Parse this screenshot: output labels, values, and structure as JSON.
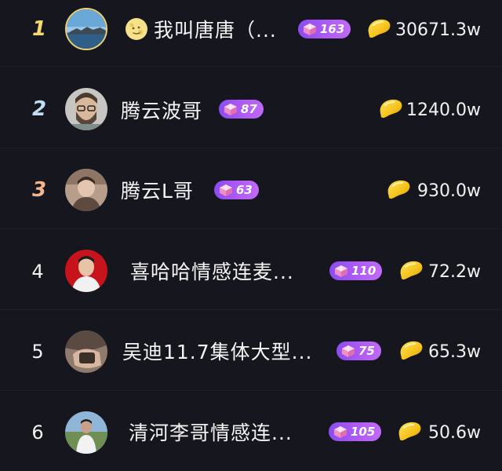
{
  "ranking": {
    "rows": [
      {
        "rank": "1",
        "name": "我叫唐唐（...",
        "level": "163",
        "value": "30671.3w"
      },
      {
        "rank": "2",
        "name": "腾云波哥",
        "level": "87",
        "value": "1240.0w"
      },
      {
        "rank": "3",
        "name": "腾云L哥",
        "level": "63",
        "value": "930.0w"
      },
      {
        "rank": "4",
        "name": "喜哈哈情感连麦...",
        "level": "110",
        "value": "72.2w"
      },
      {
        "rank": "5",
        "name": "吴迪11.7集体大型...",
        "level": "75",
        "value": "65.3w"
      },
      {
        "rank": "6",
        "name": "清河李哥情感连...",
        "level": "105",
        "value": "50.6w"
      }
    ]
  },
  "icons": {
    "level_badge": "gift-box-icon",
    "currency": "gold-bean-icon",
    "name_prefix": "moon-face-emoji"
  },
  "colors": {
    "background": "#16161e",
    "rank1": "#f6da6e",
    "rank2": "#bfe0f2",
    "rank3": "#f0b48e",
    "badge_start": "#8a4cf0",
    "badge_end": "#c06af7",
    "bean": "#f5c21b"
  }
}
